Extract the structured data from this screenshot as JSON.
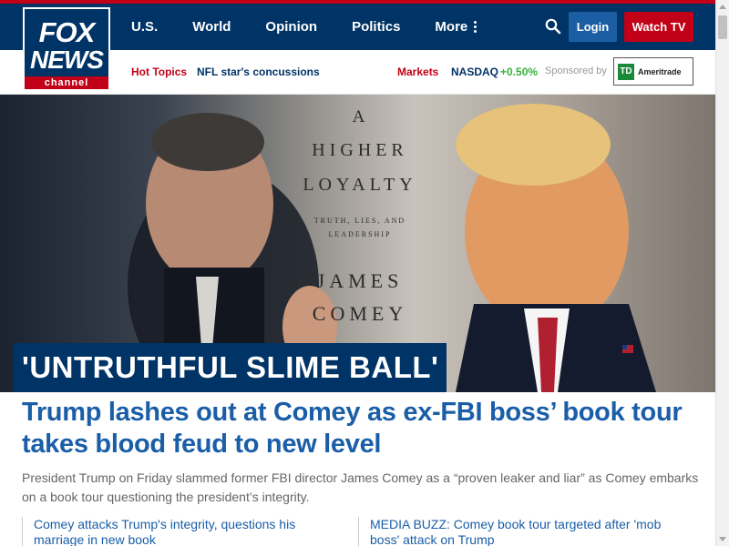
{
  "brand": {
    "line1": "FOX",
    "line2": "NEWS",
    "line3": "channel"
  },
  "nav": {
    "items": [
      "U.S.",
      "World",
      "Opinion",
      "Politics"
    ],
    "more_label": "More",
    "login_label": "Login",
    "watch_label": "Watch TV"
  },
  "subnav": {
    "hot_topics": "Hot Topics",
    "story": "NFL star's concussions",
    "markets": "Markets",
    "index": "NASDAQ",
    "change": "+0.50%",
    "sponsored": "Sponsored by",
    "sponsor_badge": "TD",
    "sponsor_name": "Ameritrade"
  },
  "hero": {
    "book": {
      "a": "A",
      "higher": "HIGHER",
      "loyalty": "LOYALTY",
      "sub1": "TRUTH, LIES, AND",
      "sub2": "LEADERSHIP",
      "author1": "JAMES",
      "author2": "COMEY"
    },
    "kicker": "'UNTRUTHFUL SLIME BALL'"
  },
  "article": {
    "headline": "Trump lashes out at Comey as ex-FBI boss’ book tour takes blood feud to new level",
    "dek": "President Trump on Friday slammed former FBI director James Comey as a “proven leaker and liar” as Comey embarks on a book tour questioning the president’s integrity.",
    "related": [
      "Comey attacks Trump's integrity, questions his marriage in new book",
      "MEDIA BUZZ: Comey book tour targeted after 'mob boss' attack on Trump"
    ]
  },
  "colors": {
    "navy": "#003366",
    "red": "#c20017",
    "link": "#1a5ea8",
    "green": "#36b33a"
  },
  "icons": {
    "search": "search-icon",
    "more": "more-dots-icon"
  }
}
